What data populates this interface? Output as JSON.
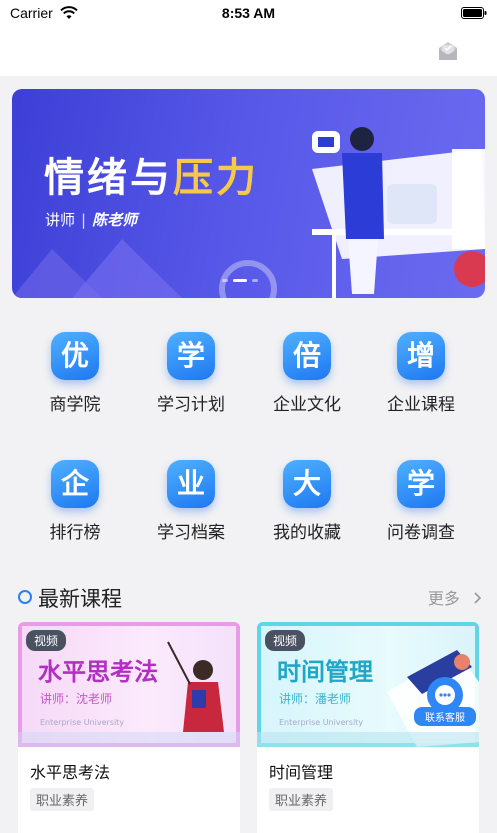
{
  "status_bar": {
    "carrier": "Carrier",
    "time": "8:53 AM"
  },
  "banner": {
    "title_part1": "情绪与",
    "title_part2": "压力",
    "lecturer_label": "讲师",
    "lecturer_sep": "|",
    "lecturer_name": "陈老师",
    "accent_color": "#f7c948"
  },
  "menu": [
    {
      "glyph": "优",
      "label": "商学院"
    },
    {
      "glyph": "学",
      "label": "学习计划"
    },
    {
      "glyph": "倍",
      "label": "企业文化"
    },
    {
      "glyph": "增",
      "label": "企业课程"
    },
    {
      "glyph": "企",
      "label": "排行榜"
    },
    {
      "glyph": "业",
      "label": "学习档案"
    },
    {
      "glyph": "大",
      "label": "我的收藏"
    },
    {
      "glyph": "学",
      "label": "问卷调查"
    }
  ],
  "section": {
    "title": "最新课程",
    "more": "更多",
    "more_icon": "chevron-right-icon"
  },
  "courses": [
    {
      "badge": "视频",
      "thumb_title": "水平思考法",
      "thumb_lecturer": "讲师：沈老师",
      "thumb_en": "Enterprise University",
      "title": "水平思考法",
      "tag": "职业素养"
    },
    {
      "badge": "视频",
      "thumb_title": "时间管理",
      "thumb_lecturer": "讲师：潘老师",
      "thumb_en": "Enterprise University",
      "title": "时间管理",
      "tag": "职业素养"
    }
  ],
  "customer_service": {
    "label": "联系客服"
  },
  "colors": {
    "primary_blue": "#2a7ff0",
    "banner_bg": "#4a4be0"
  }
}
